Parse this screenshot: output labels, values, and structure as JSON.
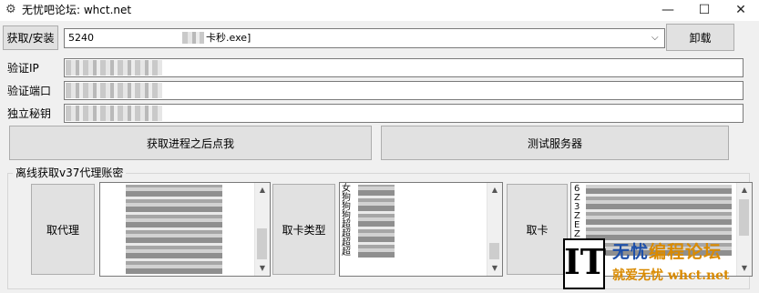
{
  "window": {
    "icon": "gear-icon",
    "title": "无忧吧论坛: whct.net",
    "minimize": "—",
    "maximize": "☐",
    "close": "✕"
  },
  "top": {
    "get_install_button": "获取/安装",
    "process_combo_pid": "5240",
    "process_combo_name": "卡秒.exe]",
    "uninstall_button": "卸载"
  },
  "fields": {
    "verify_ip_label": "验证IP",
    "verify_port_label": "验证端口",
    "secret_key_label": "独立秘钥"
  },
  "actions": {
    "get_process_button": "获取进程之后点我",
    "test_server_button": "测试服务器"
  },
  "offline_group": {
    "title": "离线获取v37代理账密",
    "get_proxy_button": "取代理",
    "get_card_type_button": "取卡类型",
    "get_card_button": "取卡",
    "list2_lines": "女\n狗\n狗\n狗\n超\n超\n超\n超",
    "list3_lines": "6\nZ\n3\nZ\nE\nZ\n9"
  },
  "watermark": {
    "logo": "IT",
    "title_part1": "无忧",
    "title_part2": "编程论坛",
    "subtitle": "就爱无忧 whct.net"
  }
}
